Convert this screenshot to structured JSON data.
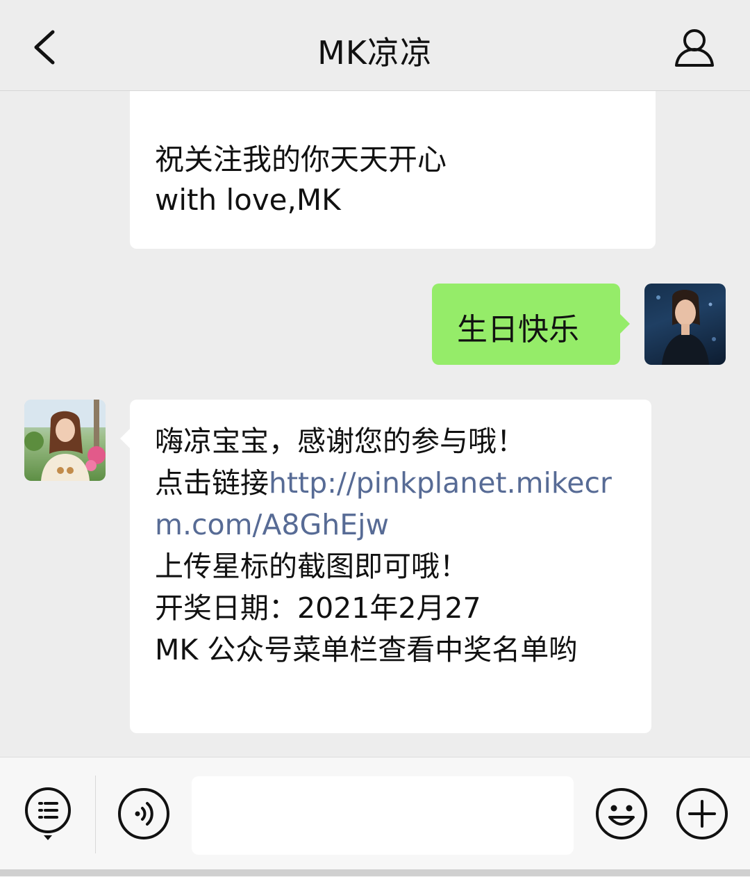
{
  "header": {
    "title": "MK凉凉",
    "back_icon": "chevron-left-icon",
    "profile_icon": "person-icon"
  },
  "messages": [
    {
      "sender": "other",
      "text": "祝关注我的你天天开心\nwith love,MK"
    },
    {
      "sender": "me",
      "text": "生日快乐"
    },
    {
      "sender": "other",
      "line1": "嗨凉宝宝，感谢您的参与哦！",
      "line2_prefix": "点击链接",
      "link": "http://pinkplanet.mikecrm.com/A8GhEjw",
      "line3": "上传星标的截图即可哦！",
      "line4": "开奖日期：2021年2月27",
      "line5": "MK 公众号菜单栏查看中奖名单哟"
    }
  ],
  "colors": {
    "background": "#ededed",
    "sent_bubble": "#95ec69",
    "received_bubble": "#ffffff",
    "link": "#576b95"
  },
  "toolbar": {
    "menu_icon": "list-menu-icon",
    "voice_icon": "voice-icon",
    "emoji_icon": "smiley-icon",
    "plus_icon": "plus-icon"
  }
}
